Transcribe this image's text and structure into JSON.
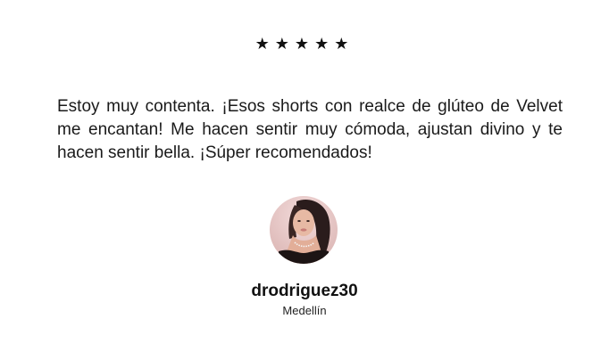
{
  "rating": {
    "value": 5,
    "max": 5,
    "star_glyph": "★",
    "color": "#111111"
  },
  "review": {
    "text": "Estoy muy contenta. ¡Esos shorts con realce de glúteo de Velvet me encantan! Me hacen sentir muy cómoda, ajustan divino y te hacen sentir bella. ¡Súper recomendados!"
  },
  "author": {
    "username": "drodriguez30",
    "city": "Medellín",
    "avatar_icon": "user-photo"
  }
}
